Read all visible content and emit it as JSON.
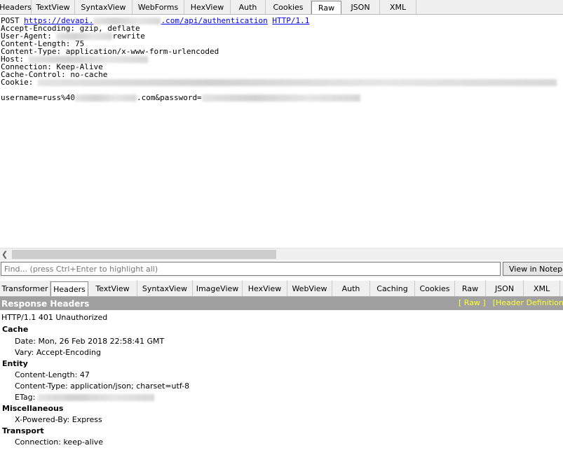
{
  "request_tabs": [
    "Headers",
    "TextView",
    "SyntaxView",
    "WebForms",
    "HexView",
    "Auth",
    "Cookies",
    "Raw",
    "JSON",
    "XML"
  ],
  "request_raw": {
    "method": "POST",
    "url_prefix": "https://devapi.",
    "url_suffix": ".com/api/authentication",
    "protocol": "HTTP/1.1",
    "accept_encoding": "Accept-Encoding: gzip, deflate",
    "user_agent_label": "User-Agent: ",
    "user_agent_suffix": "rewrite",
    "content_length": "Content-Length: 75",
    "content_type": "Content-Type: application/x-www-form-urlencoded",
    "host_label": "Host: ",
    "connection": "Connection: Keep-Alive",
    "cache_control": "Cache-Control: no-cache",
    "cookie_label": "Cookie: ",
    "body_prefix": "username=russ%40",
    "body_middle": ".com&password="
  },
  "find": {
    "placeholder": "Find... (press Ctrl+Enter to highlight all)",
    "button": "View in Notepad"
  },
  "response_tabs": [
    "Transformer",
    "Headers",
    "TextView",
    "SyntaxView",
    "ImageView",
    "HexView",
    "WebView",
    "Auth",
    "Caching",
    "Cookies",
    "Raw",
    "JSON",
    "XML"
  ],
  "response": {
    "title": "Response Headers",
    "link_raw": "[ Raw ]",
    "link_defs": "[Header Definitions]",
    "status": "HTTP/1.1 401 Unauthorized",
    "groups": [
      {
        "name": "Cache",
        "headers": [
          "Date: Mon, 26 Feb 2018 22:58:41 GMT",
          "Vary: Accept-Encoding"
        ]
      },
      {
        "name": "Entity",
        "headers": [
          "Content-Length: 47",
          "Content-Type: application/json; charset=utf-8",
          "ETag: "
        ]
      },
      {
        "name": "Miscellaneous",
        "headers": [
          "X-Powered-By: Express"
        ]
      },
      {
        "name": "Transport",
        "headers": [
          "Connection: keep-alive"
        ]
      }
    ]
  }
}
